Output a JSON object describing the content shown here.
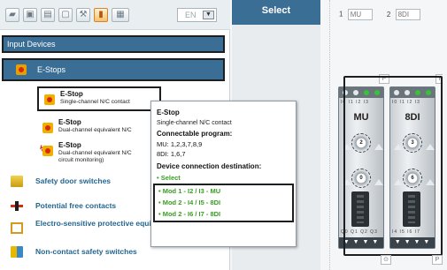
{
  "toolbar": {
    "buttons": [
      {
        "name": "folder-icon",
        "glyph": "▰"
      },
      {
        "name": "save-icon",
        "glyph": "▣"
      },
      {
        "name": "delete-icon",
        "glyph": "▤"
      },
      {
        "name": "new-document-icon",
        "glyph": "▢"
      },
      {
        "name": "wrench-icon",
        "glyph": "⚒"
      },
      {
        "name": "color-palette-icon",
        "glyph": "▮"
      },
      {
        "name": "grid-view-icon",
        "glyph": "▦"
      }
    ],
    "language": "EN",
    "dropdown_glyph": "▼"
  },
  "sidebar": {
    "category_input_devices": "Input Devices",
    "category_estops": "E-Stops",
    "estop_items": [
      {
        "title": "E-Stop",
        "subtitle": "Single-channel N/C contact"
      },
      {
        "title": "E-Stop",
        "subtitle": "Dual-channel equivalent N/C"
      },
      {
        "title": "E-Stop",
        "subtitle": "Dual-channel equivalent N/C",
        "subtitle2": "circuit monitoring)"
      }
    ],
    "bolt_glyph": "↯",
    "categories": [
      "Safety door switches",
      "Potential free contacts",
      "Electro-sensitive protective equipment (ESPE)",
      "Non-contact safety switches"
    ]
  },
  "tooltip": {
    "title": "E-Stop",
    "subtitle": "Single-channel N/C contact",
    "connectable_label": "Connectable program:",
    "mu_programs": "MU: 1,2,3,7,8,9",
    "di_programs": "8DI: 1,6,7",
    "destination_label": "Device connection destination:",
    "select_link": "• Select",
    "destinations": [
      "• Mod 1 - I2 / I3 - MU",
      "• Mod 2 - I4 / I5 - 8DI",
      "• Mod 2 - I6 / I7 - 8DI"
    ]
  },
  "workspace": {
    "select_header": "Select",
    "slot1_number": "1",
    "slot1_name": "MU",
    "slot2_number": "2",
    "slot2_name": "8DI",
    "p_label": "P",
    "info_glyph": "⊙",
    "modules": [
      {
        "name": "MU",
        "io_top": "I0 I1 I2 I3",
        "io_bottom": "Q0 Q1 Q2 Q3",
        "knob1": "2",
        "knob2": "0",
        "knob_note": "",
        "bottom": "▼ ▼ ▼ ▼"
      },
      {
        "name": "8DI",
        "io_top": "I0 I1 I2 I3",
        "io_bottom": "I4 I5 I6 I7",
        "knob1": "3",
        "knob2": "6",
        "knob_note": "1SEC",
        "bottom": "▼ ▼ ▼ ▼"
      }
    ]
  }
}
